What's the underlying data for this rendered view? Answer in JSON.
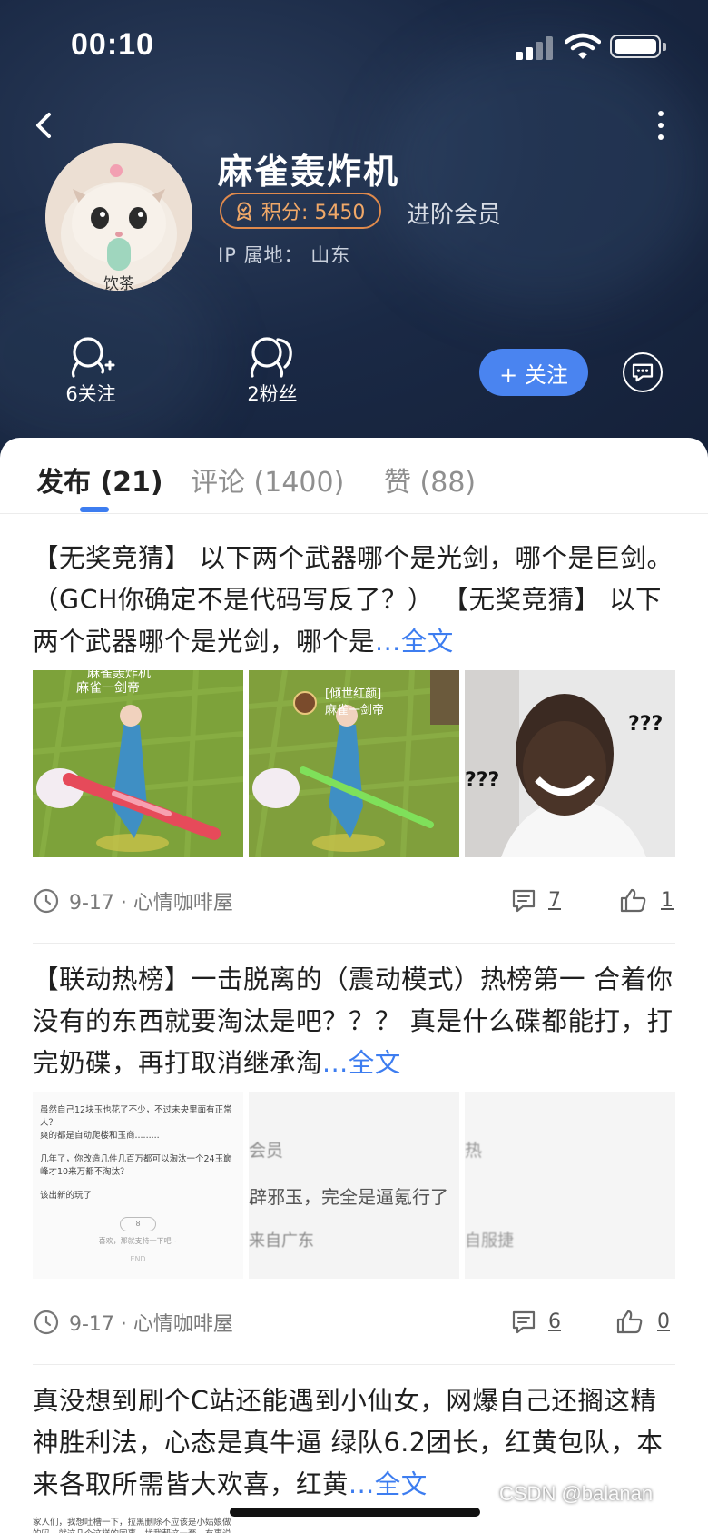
{
  "status_bar": {
    "time": "00:10"
  },
  "profile": {
    "username": "麻雀轰炸机",
    "points": "积分: 5450",
    "member_level": "进阶会员",
    "ip_location": "IP 属地： 山东",
    "avatar_caption": "饮茶",
    "following": "6关注",
    "followers": "2粉丝",
    "follow_label": "+ 关注"
  },
  "tabs": [
    {
      "label": "发布 (21)",
      "active": true
    },
    {
      "label": "评论 (1400)",
      "active": false
    },
    {
      "label": "赞 (88)",
      "active": false
    }
  ],
  "posts": [
    {
      "text": "【无奖竞猜】  以下两个武器哪个是光剑，哪个是巨剑。（GCH你确定不是代码写反了？）  【无奖竞猜】 以下两个武器哪个是光剑，哪个是",
      "read_more": "...全文",
      "images": [
        {
          "caption_line1": "麻雀轰炸机",
          "caption_line2": "麻雀一剑帝"
        },
        {
          "caption_line1": "[倾世红颜]",
          "caption_line2": "麻雀一剑帝"
        },
        {
          "caption_line1": "???",
          "caption_line2": "???"
        }
      ],
      "date": "9-17 · 心情咖啡屋",
      "comments": "7",
      "likes": "1"
    },
    {
      "text": "【联动热榜】一击脱离的（震动模式）热榜第一 合着你没有的东西就要淘汰是吧？？？ 真是什么碟都能打，打完奶碟，再打取消继承淘",
      "read_more": "...全文",
      "images": [
        {
          "line1": "虽然自己12块玉也花了不少，不过未央里面有正常人？",
          "line2": "爽的都是自动爬楼和玉商.........",
          "line3": "几年了，你改造几件几百万都可以淘汰一个24玉巅峰才10来万都不淘汰？",
          "line4": "该出新的玩了",
          "like_count": "8",
          "hint": "喜欢，那就支持一下吧~",
          "end": "END"
        },
        {
          "line1": "会员",
          "line2": "辟邪玉，完全是逼氪行了",
          "line3": "来自广东"
        },
        {
          "line1": "热",
          "line2": "自服捷"
        }
      ],
      "date": "9-17 · 心情咖啡屋",
      "comments": "6",
      "likes": "0"
    },
    {
      "text": "真没想到刷个C站还能遇到小仙女，网爆自己还搁这精神胜利法，心态是真牛逼   绿队6.2团长，红黄包队，本来各取所需皆大欢喜，红黄",
      "read_more": "...全文",
      "preview_line": "家人们，我想吐槽一下，拉黑删除不应该是小姑娘做的吗，就这几个这样的同事，找我帮这一套，有事说事有"
    }
  ],
  "watermark": "CSDN @balanan",
  "colors": {
    "accent": "#3d7df0",
    "follow_button": "#4a84f0",
    "points_border": "#e08a4c",
    "header_bg": "#1a2945"
  }
}
